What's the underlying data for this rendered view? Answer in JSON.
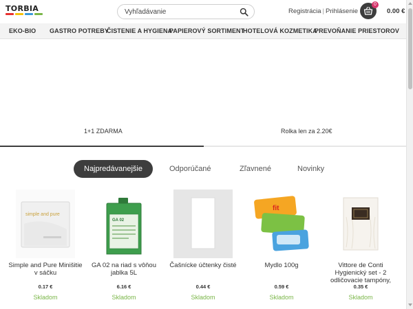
{
  "header": {
    "logo_text": "TORBIA",
    "logo_colors": [
      "#e8312f",
      "#f5c20b",
      "#3a9ad9",
      "#7ab648"
    ],
    "search_placeholder": "Vyhľadávanie",
    "register_label": "Registrácia",
    "separator": "|",
    "login_label": "Prihlásenie",
    "cart_count": "0",
    "cart_total": "0.00 €"
  },
  "nav": {
    "items": [
      "EKO-BIO",
      "GASTRO POTREBY",
      "ČISTENIE A HYGIENA",
      "PAPIEROVÝ SORTIMENT",
      "HOTELOVÁ KOZMETIKA",
      "PREVOŇANIE PRIESTOROV"
    ]
  },
  "banner": {
    "slides": [
      "1+1 ZDARMA",
      "Rolka len za 2.20€"
    ],
    "active_slide": 0
  },
  "tabs": {
    "items": [
      "Najpredávanejšie",
      "Odporúčané",
      "Zľavnené",
      "Novinky"
    ],
    "active": 0
  },
  "products": [
    {
      "name": "Simple and Pure Minišitie v sáčku",
      "price": "0.17 €",
      "stock": "Skladom",
      "img_label": "simple and pure"
    },
    {
      "name": "GA 02 na riad s vôňou jablka 5L",
      "price": "6.16 €",
      "stock": "Skladom",
      "img_label": "GA 02"
    },
    {
      "name": "Čašnícke účtenky čisté",
      "price": "0.44 €",
      "stock": "Skladom",
      "img_label": ""
    },
    {
      "name": "Mydlo 100g",
      "price": "0.59 €",
      "stock": "Skladom",
      "img_label": "fit"
    },
    {
      "name": "Vittore de Conti Hygienický set - 2 odličovacie tampóny,",
      "price": "0.35 €",
      "stock": "Skladom",
      "img_label": ""
    }
  ],
  "colors": {
    "accent_dark": "#3d3d3d",
    "stock_green": "#7ab648",
    "badge_pink": "#d6356b"
  }
}
